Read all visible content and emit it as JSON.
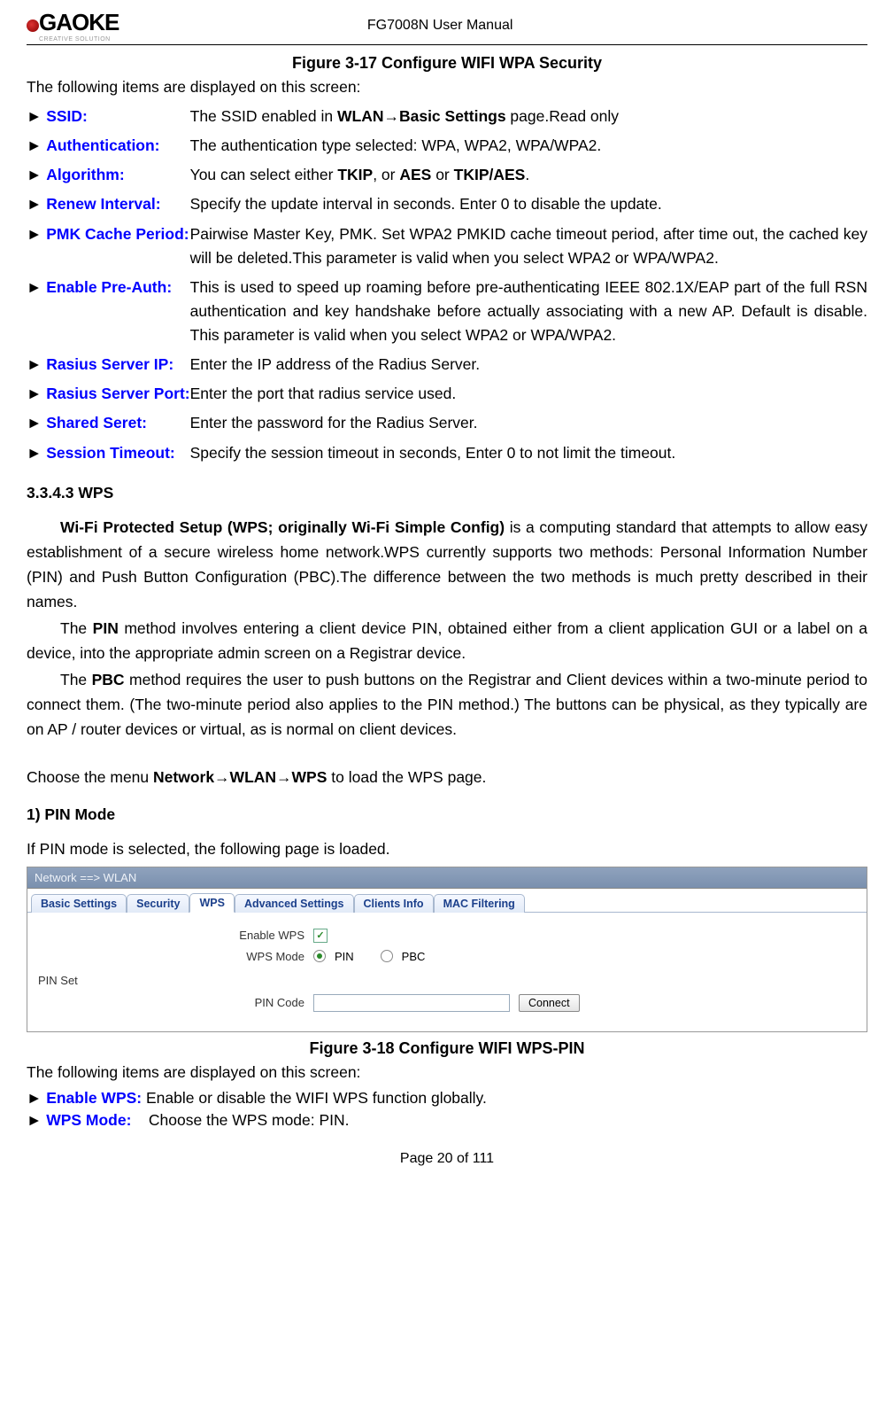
{
  "header": {
    "doc_title": "FG7008N User Manual",
    "logo_main": "GAOKE",
    "logo_sub": "CREATIVE SOLUTION"
  },
  "figure_17_caption": "Figure 3-17   Configure WIFI WPA Security",
  "intro_17": "The following items are displayed on this screen:",
  "defs_17": [
    {
      "label": "SSID:",
      "desc_pre": "The SSID enabled in ",
      "desc_bold": "WLAN→Basic Settings",
      "desc_post": " page.Read only"
    },
    {
      "label": "Authentication:",
      "desc": "The authentication type selected: WPA, WPA2, WPA/WPA2."
    },
    {
      "label": "Algorithm:",
      "desc_pre": "You can select either ",
      "b1": "TKIP",
      "mid1": ", or ",
      "b2": "AES",
      "mid2": " or ",
      "b3": "TKIP/AES",
      "desc_post": "."
    },
    {
      "label": "Renew Interval:",
      "desc": "Specify the update interval in seconds. Enter 0 to disable the update."
    },
    {
      "label": "PMK Cache Period:",
      "desc": "Pairwise Master Key, PMK. Set WPA2 PMKID cache timeout period, after time out, the cached key will be deleted.This parameter is valid when you select WPA2 or WPA/WPA2."
    },
    {
      "label": "Enable Pre-Auth:",
      "desc": "This is used to speed up roaming before pre-authenticating IEEE 802.1X/EAP part of the full RSN authentication and key handshake before actually associating with a new AP. Default is disable. This parameter is valid when you select WPA2 or WPA/WPA2."
    },
    {
      "label": "Rasius Server IP:",
      "desc": "Enter the IP address of the Radius Server."
    },
    {
      "label": "Rasius Server Port:",
      "desc": "Enter the port that radius service used."
    },
    {
      "label": "Shared Seret:",
      "desc": "Enter the password for the Radius Server."
    },
    {
      "label": "Session Timeout:",
      "desc": "Specify the session timeout in seconds, Enter 0 to not limit the timeout."
    }
  ],
  "section_3343": "3.3.4.3      WPS",
  "wps_para1_bold": "Wi-Fi Protected Setup (WPS; originally Wi-Fi Simple Config)",
  "wps_para1_rest": " is a computing standard that attempts to allow easy establishment of a secure wireless home network.WPS currently supports two methods: Personal Information Number (PIN) and Push Button Configuration (PBC).The difference between the two methods is much pretty described in their names.",
  "wps_para2_pre": "The ",
  "wps_para2_bold": "PIN",
  "wps_para2_post": " method involves entering a client device PIN, obtained either from a client application GUI or a label on a device, into the appropriate admin screen on a Registrar device.",
  "wps_para3_pre": "The ",
  "wps_para3_bold": "PBC",
  "wps_para3_post": " method requires the user to push buttons on the Registrar and Client devices within a two-minute period to connect them. (The two-minute period also applies to the PIN method.) The buttons can be physical, as they typically are on AP / router devices or virtual, as is normal on client devices.",
  "choose_menu_pre": "Choose the menu ",
  "choose_menu_bold": "Network→WLAN→WPS",
  "choose_menu_post": " to load the WPS page.",
  "pin_mode_heading": "1) PIN Mode",
  "pin_mode_intro": "If PIN mode is selected, the following page is loaded.",
  "screenshot": {
    "titlebar": "Network ==> WLAN",
    "tabs": [
      "Basic Settings",
      "Security",
      "WPS",
      "Advanced Settings",
      "Clients Info",
      "MAC Filtering"
    ],
    "active_tab_index": 2,
    "enable_wps_label": "Enable WPS",
    "enable_wps_checked": true,
    "wps_mode_label": "WPS Mode",
    "wps_mode_pin_label": "PIN",
    "wps_mode_pbc_label": "PBC",
    "wps_mode_selected": "PIN",
    "pin_set_section": "PIN Set",
    "pin_code_label": "PIN Code",
    "pin_code_value": "",
    "connect_button": "Connect"
  },
  "figure_18_caption": "Figure 3-18   Configure WIFI WPS-PIN",
  "intro_18": "The following items are displayed on this screen:",
  "defs_18": [
    {
      "label": "Enable WPS:",
      "desc": "Enable or disable the WIFI WPS function globally."
    },
    {
      "label": "WPS Mode:",
      "desc": "Choose the WPS mode: PIN."
    }
  ],
  "footer": "Page 20 of 111"
}
